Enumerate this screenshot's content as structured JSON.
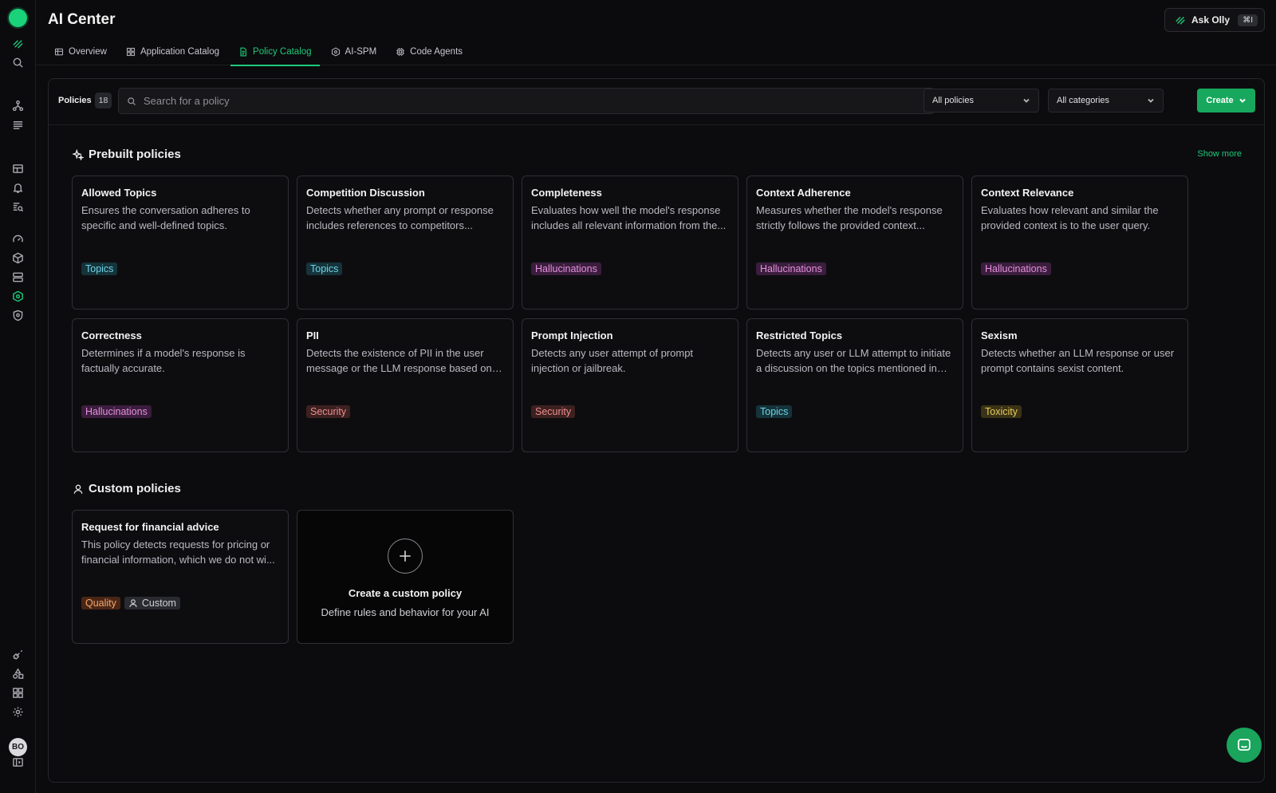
{
  "app": {
    "title": "AI Center"
  },
  "header": {
    "ask_label": "Ask Olly",
    "ask_shortcut": "⌘I"
  },
  "tabs": [
    {
      "label": "Overview",
      "icon": "table-icon"
    },
    {
      "label": "Application Catalog",
      "icon": "grid-icon"
    },
    {
      "label": "Policy Catalog",
      "icon": "document-icon",
      "active": true
    },
    {
      "label": "AI-SPM",
      "icon": "shield-icon"
    },
    {
      "label": "Code Agents",
      "icon": "cpu-icon"
    }
  ],
  "toolbar": {
    "policies_label": "Policies",
    "policies_count": "18",
    "search_placeholder": "Search for a policy",
    "filter_policies": "All policies",
    "filter_categories": "All categories",
    "create_label": "Create"
  },
  "prebuilt": {
    "title": "Prebuilt policies",
    "show_more": "Show more",
    "cards": [
      {
        "title": "Allowed Topics",
        "desc": "Ensures the conversation adheres to specific and well-defined topics.",
        "tag": "Topics",
        "tag_type": "topics"
      },
      {
        "title": "Competition Discussion",
        "desc": "Detects whether any prompt or response includes references to competitors...",
        "tag": "Topics",
        "tag_type": "topics"
      },
      {
        "title": "Completeness",
        "desc": "Evaluates how well the model's response includes all relevant information from the...",
        "tag": "Hallucinations",
        "tag_type": "hall"
      },
      {
        "title": "Context Adherence",
        "desc": "Measures whether the model's response strictly follows the provided context...",
        "tag": "Hallucinations",
        "tag_type": "hall"
      },
      {
        "title": "Context Relevance",
        "desc": "Evaluates how relevant and similar the provided context is to the user query.",
        "tag": "Hallucinations",
        "tag_type": "hall"
      },
      {
        "title": "Correctness",
        "desc": "Determines if a model's response is factually accurate.",
        "tag": "Hallucinations",
        "tag_type": "hall"
      },
      {
        "title": "PII",
        "desc": "Detects the existence of PII in the user message or the LLM response based on t...",
        "tag": "Security",
        "tag_type": "sec"
      },
      {
        "title": "Prompt Injection",
        "desc": "Detects any user attempt of prompt injection or jailbreak.",
        "tag": "Security",
        "tag_type": "sec"
      },
      {
        "title": "Restricted Topics",
        "desc": "Detects any user or LLM attempt to initiate a discussion on the topics mentioned in th...",
        "tag": "Topics",
        "tag_type": "topics"
      },
      {
        "title": "Sexism",
        "desc": "Detects whether an LLM response or user prompt contains sexist content.",
        "tag": "Toxicity",
        "tag_type": "tox"
      }
    ]
  },
  "custom": {
    "title": "Custom policies",
    "card": {
      "title": "Request for financial advice",
      "desc": "This policy detects requests for pricing or financial information, which we do not wi...",
      "tag1": "Quality",
      "tag2": "Custom"
    },
    "create_title": "Create a custom policy",
    "create_sub": "Define rules and behavior for your AI"
  },
  "user": {
    "initials": "BO"
  }
}
